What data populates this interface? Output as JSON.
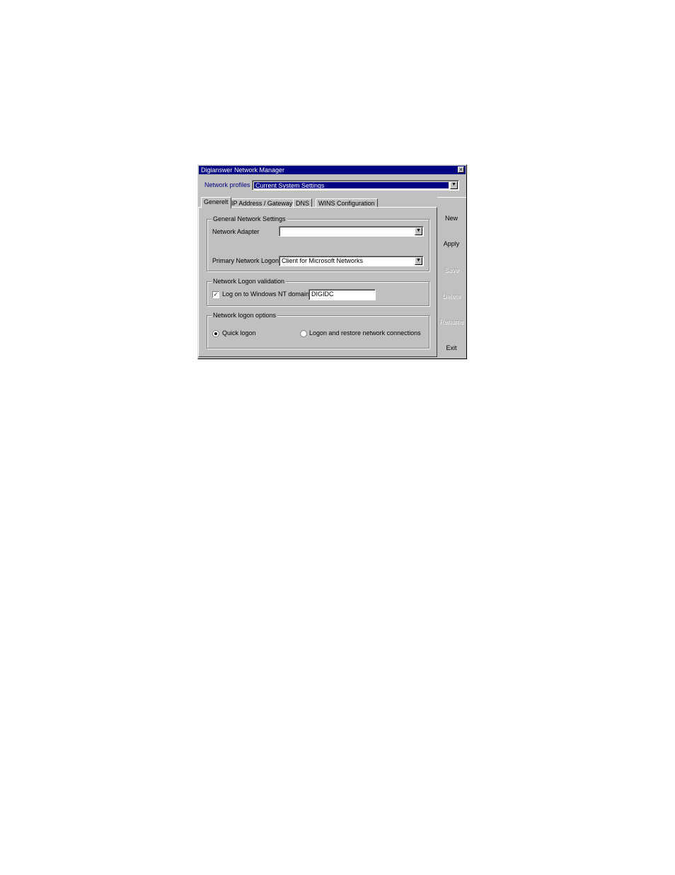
{
  "window": {
    "title": "Digianswer Network Manager",
    "close_glyph": "×"
  },
  "profiles": {
    "label": "Network profiles",
    "selected": "Current System Settings"
  },
  "tabs": [
    {
      "label": "Generelt",
      "active": true
    },
    {
      "label": "IP Address / Gateway",
      "active": false
    },
    {
      "label": "DNS",
      "active": false
    },
    {
      "label": "WINS Configuration",
      "active": false
    }
  ],
  "general_settings": {
    "title": "General Network Settings",
    "adapter_label": "Network Adapter",
    "adapter_value": "",
    "logon_label": "Primary Network Logon",
    "logon_value": "Client for Microsoft Networks"
  },
  "validation": {
    "title": "Network Logon validation",
    "checkbox_label": "Log on to Windows NT domain",
    "checked": true,
    "check_glyph": "✓",
    "domain_value": "DIGIDC"
  },
  "logon_options": {
    "title": "Network logon options",
    "quick_label": "Quick logon",
    "restore_label": "Logon and restore network connections",
    "selected": "quick"
  },
  "buttons": {
    "new": "New",
    "apply": "Apply",
    "save": "Save",
    "delete": "Delete",
    "rename": "Rename",
    "exit": "Exit"
  },
  "icons": {
    "dropdown_arrow": "▼"
  }
}
